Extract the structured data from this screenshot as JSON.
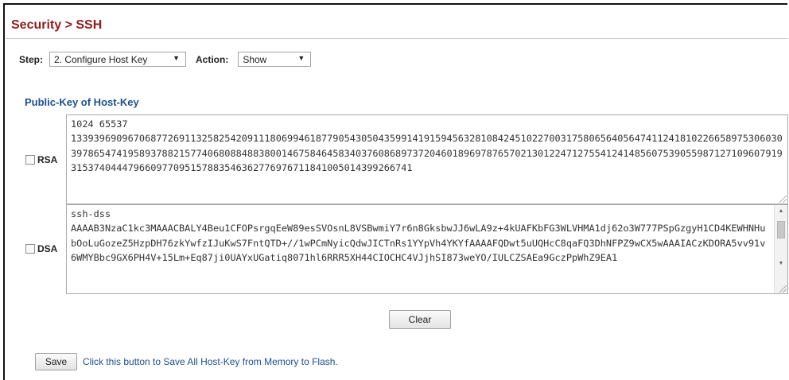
{
  "header": {
    "title": "Security > SSH"
  },
  "controls": {
    "step_label": "Step:",
    "step_value": "2. Configure Host Key",
    "action_label": "Action:",
    "action_value": "Show"
  },
  "section": {
    "title": "Public-Key of Host-Key"
  },
  "rsa": {
    "label": "RSA",
    "value": "1024 65537\n1339396909670687726911325825420911180699461877905430504359914191594563281084245102270031758065640564741124181022665897530603039786547419589378821577406808848838001467584645834037608689737204601896978765702130122471275541241485607539055987127109607919315374044479660977095157883546362776976711841005014399266741"
  },
  "dsa": {
    "label": "DSA",
    "value": "ssh-dss\nAAAAB3NzaC1kc3MAAACBALY4Beu1CFOPsrgqEeW89esSVOsnL8VSBwmiY7r6n8GksbwJJ6wLA9z+4kUAFKbFG3WLVHMA1dj62o3W777PSpGzgyH1CD4KEWHNHubOoLuGozeZ5HzpDH76zkYwfzIJuKwS7FntQTD+//1wPCmNyicQdwJICTnRs1YYpVh4YKYfAAAAFQDwt5uUQHcC8qaFQ3DhNFPZ9wCX5wAAAIACzKDORA5vv91v6WMYBbc9GX6PH4V+15Lm+Eq87ji0UAYxUGatiq8071hl6RRR5XH44CIOCHC4VJjhSI873weYO/IULCZSAEa9GczPpWhZ9EA1"
  },
  "buttons": {
    "clear_label": "Clear",
    "save_label": "Save"
  },
  "footer": {
    "save_hint": "Click this button to Save All Host-Key from Memory to Flash."
  },
  "colors": {
    "title": "#8b1e1e",
    "section_title": "#1f4e8c",
    "hint_text": "#1f4e8c"
  }
}
